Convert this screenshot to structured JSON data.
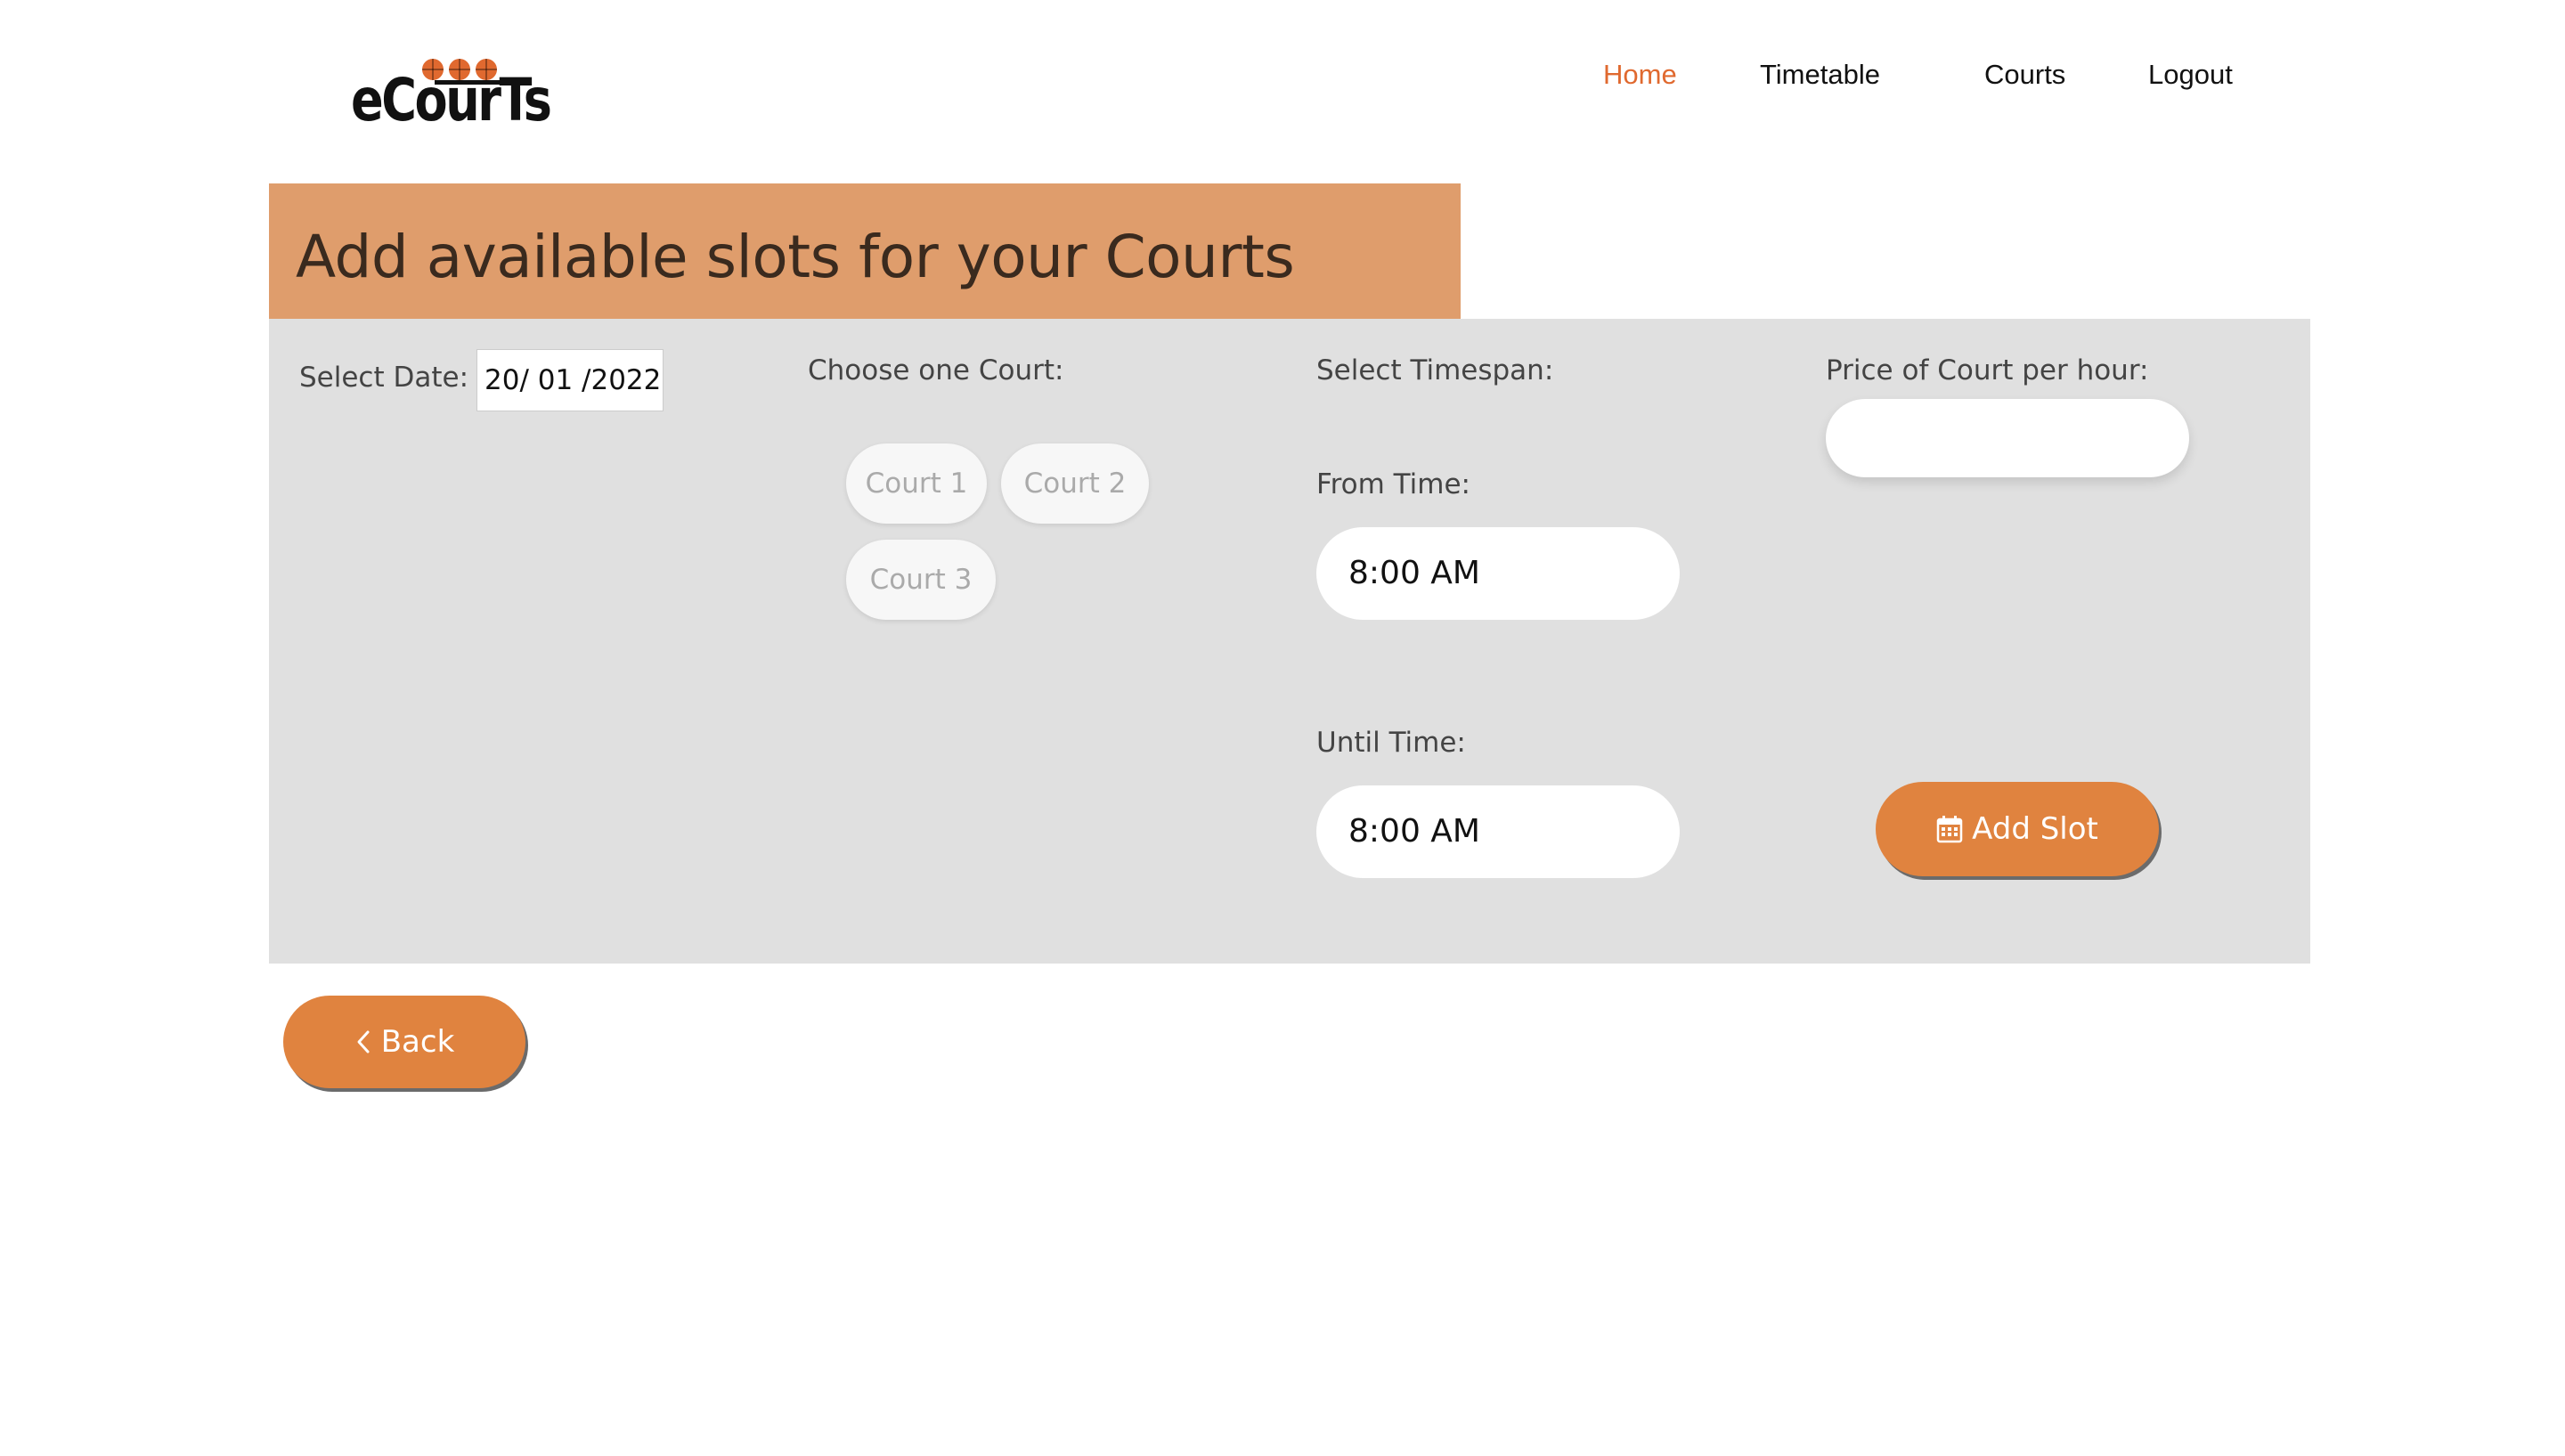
{
  "header": {
    "logo_text": "eCourTs",
    "nav": {
      "home": "Home",
      "timetable": "Timetable",
      "courts": "Courts",
      "logout": "Logout"
    }
  },
  "main": {
    "title": "Add available slots for your Courts"
  },
  "form": {
    "date_label": "Select Date:",
    "date_value": "20/ 01 /2022",
    "court_label": "Choose one Court:",
    "courts": [
      "Court 1",
      "Court 2",
      "Court 3"
    ],
    "timespan_label": "Select Timespan:",
    "from_label": "From Time:",
    "from_value": "8:00 AM",
    "until_label": "Until Time:",
    "until_value": "8:00 AM",
    "price_label": "Price of Court per hour:",
    "price_value": "",
    "add_slot_label": "Add Slot"
  },
  "actions": {
    "back_label": "Back"
  },
  "colors": {
    "accent": "#e0833f",
    "nav_active": "#e0692f",
    "title_banner": "#df9d6c",
    "panel_bg": "#e0e0e0"
  },
  "icons": {
    "logo": "basketball-icon",
    "add_slot": "calendar-icon",
    "back": "chevron-left-icon"
  }
}
